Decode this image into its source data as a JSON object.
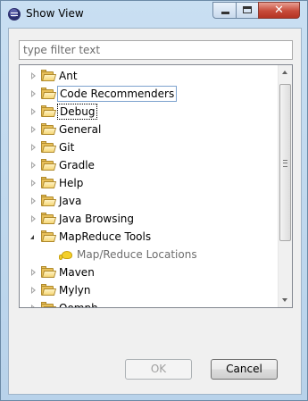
{
  "window": {
    "title": "Show View",
    "icon": "eclipse-icon",
    "controls": {
      "minimize": "minimize-icon",
      "maximize": "maximize-icon",
      "close_glyph": "✕"
    }
  },
  "filter": {
    "placeholder": "type filter text",
    "value": ""
  },
  "tree": {
    "items": [
      {
        "label": "Ant",
        "expanded": false
      },
      {
        "label": "Code Recommenders",
        "expanded": false,
        "hover": true
      },
      {
        "label": "Debug",
        "expanded": false,
        "focused": true
      },
      {
        "label": "General",
        "expanded": false
      },
      {
        "label": "Git",
        "expanded": false
      },
      {
        "label": "Gradle",
        "expanded": false
      },
      {
        "label": "Help",
        "expanded": false
      },
      {
        "label": "Java",
        "expanded": false
      },
      {
        "label": "Java Browsing",
        "expanded": false
      },
      {
        "label": "MapReduce Tools",
        "expanded": true
      },
      {
        "label": "Map/Reduce Locations",
        "child": true,
        "icon": "hadoop-elephant-icon"
      },
      {
        "label": "Maven",
        "expanded": false
      },
      {
        "label": "Mylyn",
        "expanded": false
      },
      {
        "label": "Oomph",
        "expanded": false,
        "partial": true
      }
    ]
  },
  "buttons": {
    "ok": "OK",
    "cancel": "Cancel"
  },
  "colors": {
    "frame": "#c9dff2",
    "folder": "#e8c05a",
    "hover_border": "#7da2ce",
    "close_button": "#c74a39"
  }
}
